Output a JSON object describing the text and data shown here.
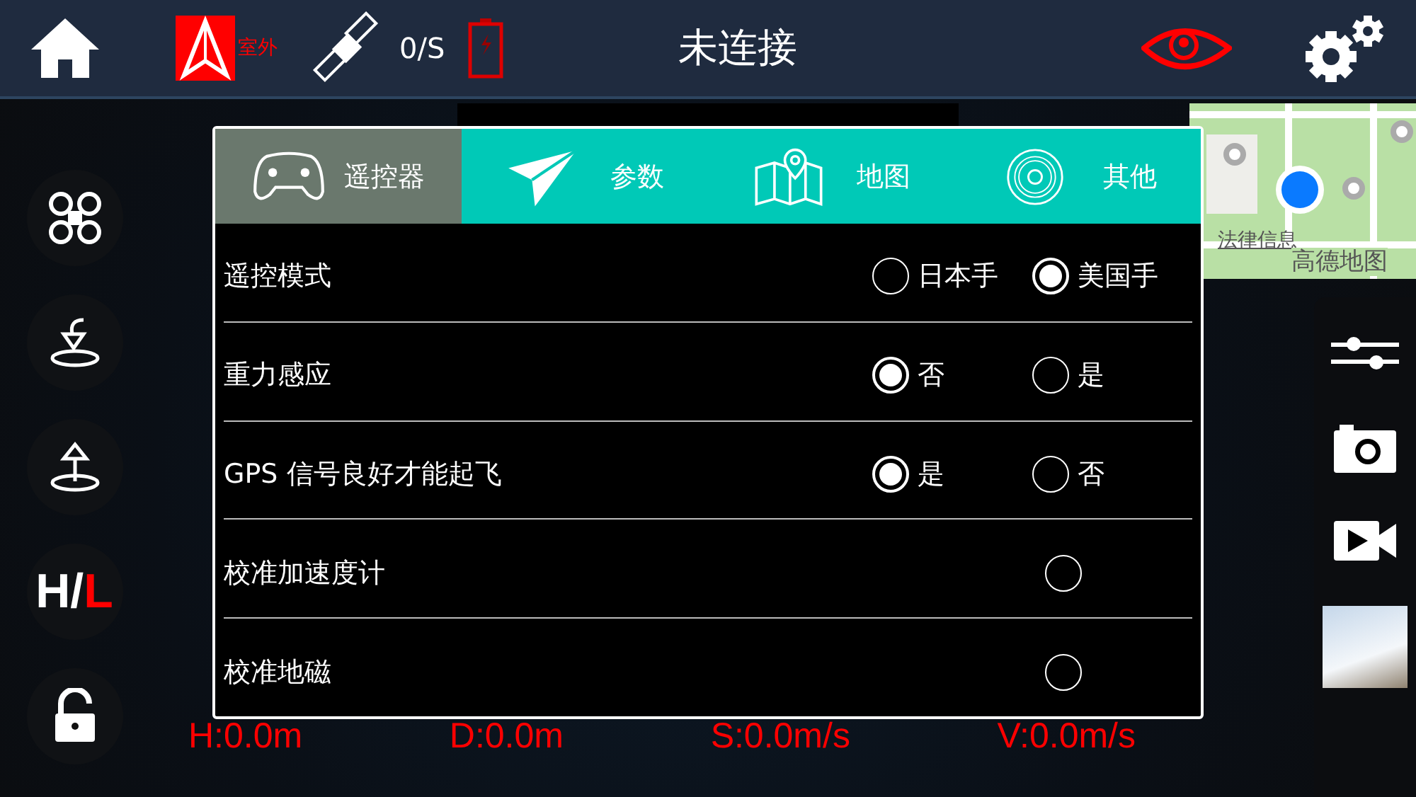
{
  "top_bar": {
    "location_mode": "室外",
    "satellites": "0/S",
    "status": "未连接"
  },
  "map": {
    "legal_link": "法律信息",
    "provider": "高德地图"
  },
  "hl_toggle": [
    {
      "text": "H",
      "highlighted": false
    },
    {
      "text": "/",
      "highlighted": false
    },
    {
      "text": "L",
      "highlighted": true
    }
  ],
  "tabs": [
    {
      "label": "遥控器",
      "selected": true
    },
    {
      "label": "参数",
      "selected": false
    },
    {
      "label": "地图",
      "selected": false
    },
    {
      "label": "其他",
      "selected": false
    }
  ],
  "rows": [
    {
      "label": "遥控模式",
      "options": [
        {
          "label": "日本手",
          "selected": false
        },
        {
          "label": "美国手",
          "selected": true
        }
      ]
    },
    {
      "label": "重力感应",
      "options": [
        {
          "label": "否",
          "selected": true
        },
        {
          "label": "是",
          "selected": false
        }
      ]
    },
    {
      "label": "GPS 信号良好才能起飞",
      "options": [
        {
          "label": "是",
          "selected": true
        },
        {
          "label": "否",
          "selected": false
        }
      ]
    },
    {
      "label": "校准加速度计",
      "options": [
        {
          "selected": false
        }
      ]
    },
    {
      "label": "校准地磁",
      "options": [
        {
          "selected": false
        }
      ]
    }
  ],
  "telemetry": [
    "H:0.0m",
    "D:0.0m",
    "S:0.0m/s",
    "V:0.0m/s"
  ]
}
